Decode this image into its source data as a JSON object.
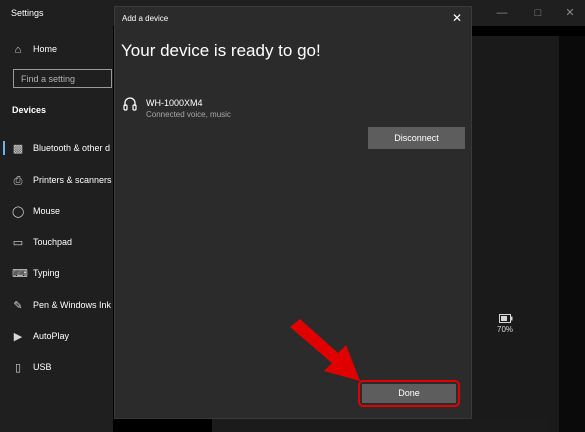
{
  "settings": {
    "title": "Settings",
    "search_placeholder": "Find a setting",
    "section": "Devices",
    "nav": [
      {
        "label": "Home",
        "icon": "home-icon"
      },
      {
        "label": "Bluetooth & other d",
        "icon": "bluetooth-icon"
      },
      {
        "label": "Printers & scanners",
        "icon": "printer-icon"
      },
      {
        "label": "Mouse",
        "icon": "mouse-icon"
      },
      {
        "label": "Touchpad",
        "icon": "touchpad-icon"
      },
      {
        "label": "Typing",
        "icon": "keyboard-icon"
      },
      {
        "label": "Pen & Windows Ink",
        "icon": "pen-icon"
      },
      {
        "label": "AutoPlay",
        "icon": "autoplay-icon"
      },
      {
        "label": "USB",
        "icon": "usb-icon"
      }
    ]
  },
  "dialog": {
    "title": "Add a device",
    "heading": "Your device is ready to go!",
    "device": {
      "name": "WH-1000XM4",
      "status": "Connected voice, music"
    },
    "disconnect_label": "Disconnect",
    "done_label": "Done"
  },
  "battery": {
    "text": "70%"
  },
  "colors": {
    "accent": "#6fb2ea",
    "highlight": "#e00000",
    "button": "#5d5d5d"
  }
}
